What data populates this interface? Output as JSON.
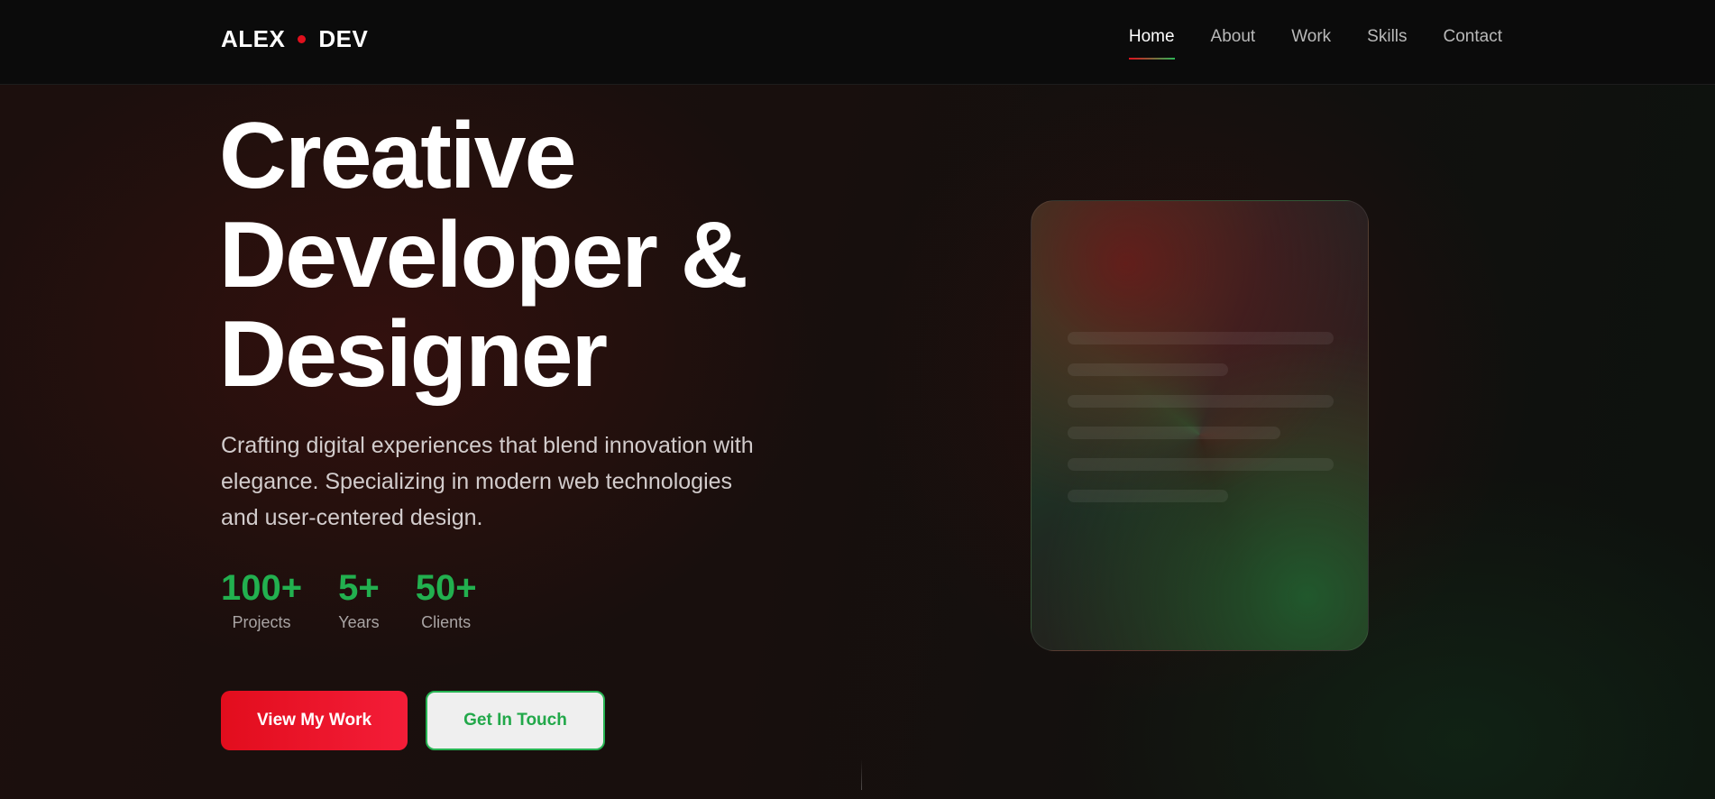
{
  "header": {
    "logo_left": "ALEX",
    "logo_right": "DEV",
    "nav": [
      {
        "label": "Home",
        "active": true
      },
      {
        "label": "About",
        "active": false
      },
      {
        "label": "Work",
        "active": false
      },
      {
        "label": "Skills",
        "active": false
      },
      {
        "label": "Contact",
        "active": false
      }
    ]
  },
  "hero": {
    "title_lines": [
      "Creative",
      "Developer &",
      "Designer"
    ],
    "subtitle": "Crafting digital experiences that blend innovation with elegance. Specializing in modern web technologies and user-centered design.",
    "stats": [
      {
        "value": "100+",
        "label": "Projects"
      },
      {
        "value": "5+",
        "label": "Years"
      },
      {
        "value": "50+",
        "label": "Clients"
      }
    ],
    "primary_button": "View My Work",
    "secondary_button": "Get In Touch"
  },
  "colors": {
    "accent_red": "#e0101d",
    "accent_green": "#22b04f",
    "header_bg": "#0b0b0b"
  }
}
